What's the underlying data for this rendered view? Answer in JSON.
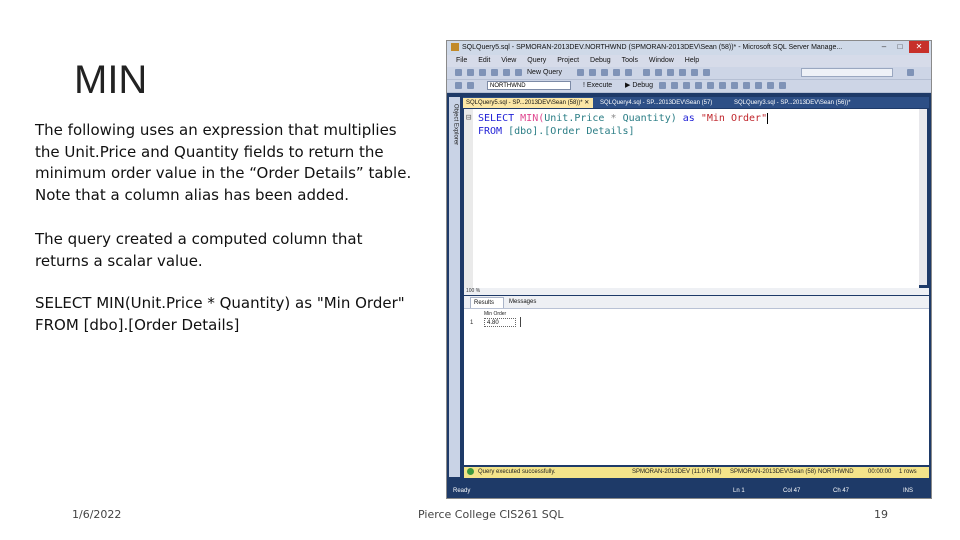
{
  "slide": {
    "title": "MIN",
    "para1": "The following uses an expression that multiplies the Unit.Price and Quantity fields to return the minimum order value in the “Order Details” table. Note that a column alias has been added.",
    "para2": "The query created a computed column that returns a scalar value.",
    "para3": "SELECT MIN(Unit.Price * Quantity) as \"Min Order\" FROM [dbo].[Order Details]",
    "footer_date": "1/6/2022",
    "footer_course": "Pierce College CIS261 SQL",
    "footer_page": "19"
  },
  "ssms": {
    "title": "SQLQuery5.sql - SPMORAN-2013DEV.NORTHWND (SPMORAN-2013DEV\\Sean (58))* - Microsoft SQL Server Manage...",
    "window_controls": {
      "minimize": "–",
      "maximize": "□",
      "close": "✕"
    },
    "menu": [
      "File",
      "Edit",
      "View",
      "Query",
      "Project",
      "Debug",
      "Tools",
      "Window",
      "Help"
    ],
    "toolbar": {
      "new_query": "New Query",
      "database": "NORTHWND",
      "execute": "! Execute",
      "debug": "▶ Debug"
    },
    "object_explorer": "Object Explorer",
    "tabs": [
      "SQLQuery5.sql - SP...2013DEV\\Sean (58))*",
      "SQLQuery4.sql - SP...2013DEV\\Sean (57)",
      "SQLQuery3.sql - SP...2013DEV\\Sean (56))*"
    ],
    "tab_close": "✕",
    "code": {
      "select": "SELECT",
      "min": "MIN(",
      "unit_price": "Unit.Price",
      "star": "*",
      "quantity": "Quantity)",
      "as": "as",
      "alias": "\"Min Order\"",
      "from": "FROM",
      "table": "[dbo].[Order Details]"
    },
    "zoom": "100 %",
    "result_tabs": [
      "Results",
      "Messages"
    ],
    "results": {
      "column": "Min Order",
      "row_number": "1",
      "value": "4.80"
    },
    "status": {
      "message": "Query executed successfully.",
      "server": "SPMORAN-2013DEV (11.0 RTM)",
      "user": "SPMORAN-2013DEV\\Sean (58)",
      "database": "NORTHWND",
      "time": "00:00:00",
      "rows": "1 rows"
    },
    "statusbar": {
      "ready": "Ready",
      "ln": "Ln 1",
      "col": "Col 47",
      "ch": "Ch 47",
      "ins": "INS"
    }
  }
}
